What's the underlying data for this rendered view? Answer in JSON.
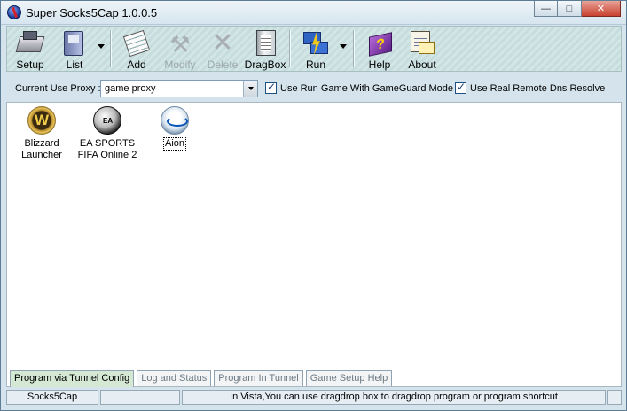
{
  "window": {
    "title": "Super Socks5Cap 1.0.0.5"
  },
  "toolbar": {
    "setup": "Setup",
    "list": "List",
    "add": "Add",
    "modify": "Modify",
    "delete": "Delete",
    "dragbox": "DragBox",
    "run": "Run",
    "help": "Help",
    "about": "About"
  },
  "proxy": {
    "label": "Current Use Proxy :",
    "selected": "game proxy",
    "gameguard": {
      "label": "Use Run Game With GameGuard Mode",
      "checked": true
    },
    "remote_dns": {
      "label": "Use Real Remote Dns Resolve",
      "checked": true
    }
  },
  "programs": [
    {
      "line1": "Blizzard",
      "line2": "Launcher",
      "icon": "blizzard-launcher-icon"
    },
    {
      "line1": "EA SPORTS",
      "line2": "FIFA Online 2",
      "icon": "ea-sports-icon"
    },
    {
      "line1": "Aion",
      "line2": "",
      "icon": "aion-icon"
    }
  ],
  "tabs": [
    {
      "label": "Program via Tunnel Config",
      "active": true
    },
    {
      "label": "Log and Status",
      "active": false
    },
    {
      "label": "Program In Tunnel",
      "active": false
    },
    {
      "label": "Game Setup Help",
      "active": false
    }
  ],
  "status": {
    "app": "Socks5Cap",
    "middle": "",
    "message": "In Vista,You can use dragdrop box to dragdrop program or program shortcut"
  },
  "colors": {
    "active_tab": "#d4e8d4",
    "toolbar_bg": "#d2e6e6",
    "frame": "#d4e3ec"
  }
}
